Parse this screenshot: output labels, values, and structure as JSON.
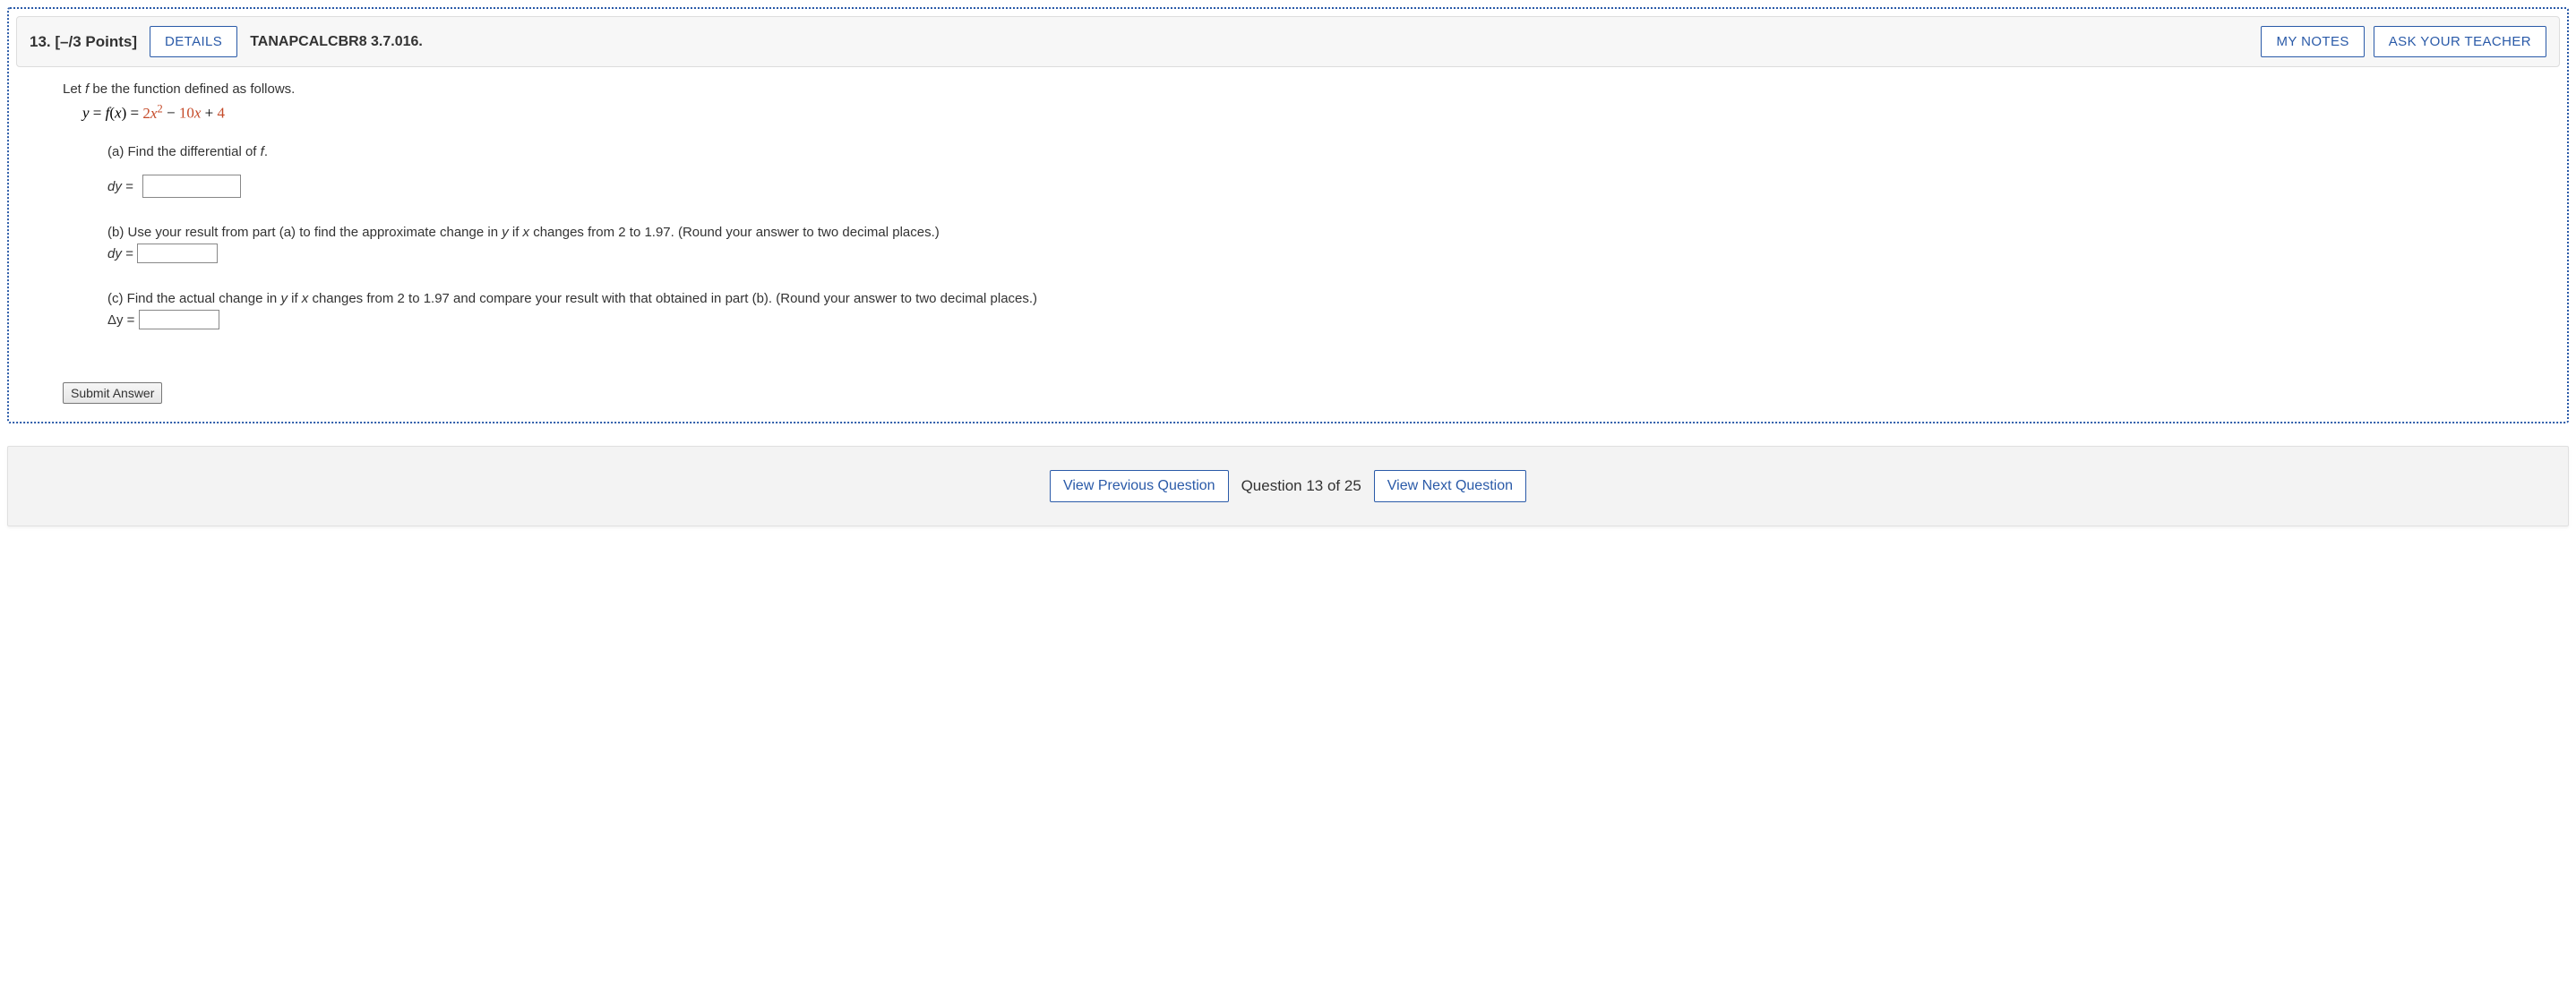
{
  "header": {
    "qnum": "13.",
    "points": "[–/3 Points]",
    "details_btn": "DETAILS",
    "reference": "TANAPCALCBR8 3.7.016.",
    "my_notes_btn": "MY NOTES",
    "ask_teacher_btn": "ASK YOUR TEACHER"
  },
  "intro": "Let f be the function defined as follows.",
  "equation": {
    "lhs": "y = f(x) =",
    "t1": "2x",
    "sup": "2",
    "t2": " − ",
    "t3": "10x",
    "t4": " + 4"
  },
  "part_a": {
    "prompt": "(a) Find the differential of f.",
    "label": "dy ="
  },
  "part_b": {
    "prompt": "(b) Use your result from part (a) to find the approximate change in y if x changes from 2 to 1.97. (Round your answer to two decimal places.)",
    "label": "dy ="
  },
  "part_c": {
    "prompt": "(c) Find the actual change in y if x changes from 2 to 1.97 and compare your result with that obtained in part (b). (Round your answer to two decimal places.)",
    "label": "Δy ="
  },
  "submit_btn": "Submit Answer",
  "nav": {
    "prev": "View Previous Question",
    "status": "Question 13 of 25",
    "next": "View Next Question"
  }
}
